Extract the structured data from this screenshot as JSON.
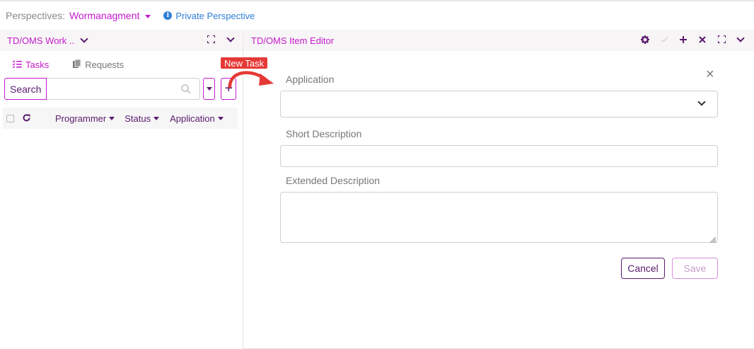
{
  "perspectives": {
    "label": "Perspectives:",
    "value": "Wormanagment",
    "private_label": "Private Perspective",
    "info_icon_glyph": "i"
  },
  "left_panel": {
    "title": "TD/OMS Work ..",
    "tabs": [
      {
        "label": "Tasks",
        "icon": "tasks-list-icon"
      },
      {
        "label": "Requests",
        "icon": "copy-icon"
      }
    ],
    "search_label": "Search",
    "search_value": "",
    "add_glyph": "+",
    "columns": [
      "Programmer",
      "Status",
      "Application"
    ]
  },
  "right_panel": {
    "title": "TD/OMS Item Editor",
    "header_icons": [
      "gear-icon",
      "check-icon",
      "plus-icon",
      "x-icon",
      "expand-icon",
      "chevron-down-icon"
    ],
    "close_glyph": "×",
    "fields": {
      "application_label": "Application",
      "application_value": "",
      "short_desc_label": "Short Description",
      "short_desc_value": "",
      "extended_desc_label": "Extended Description",
      "extended_desc_value": ""
    },
    "cancel_label": "Cancel",
    "save_label": "Save"
  },
  "callout": {
    "label": "New Task"
  },
  "colors": {
    "accent": "#c41acd",
    "dark_purple": "#5a1a6e",
    "link_blue": "#2f7fd6",
    "callout_red": "#e53935"
  }
}
